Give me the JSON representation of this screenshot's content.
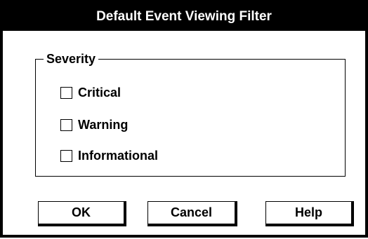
{
  "window": {
    "title": "Default Event Viewing Filter"
  },
  "severity": {
    "legend": "Severity",
    "options": [
      {
        "label": "Critical",
        "checked": false
      },
      {
        "label": "Warning",
        "checked": false
      },
      {
        "label": "Informational",
        "checked": false
      }
    ]
  },
  "buttons": {
    "ok": "OK",
    "cancel": "Cancel",
    "help": "Help"
  }
}
